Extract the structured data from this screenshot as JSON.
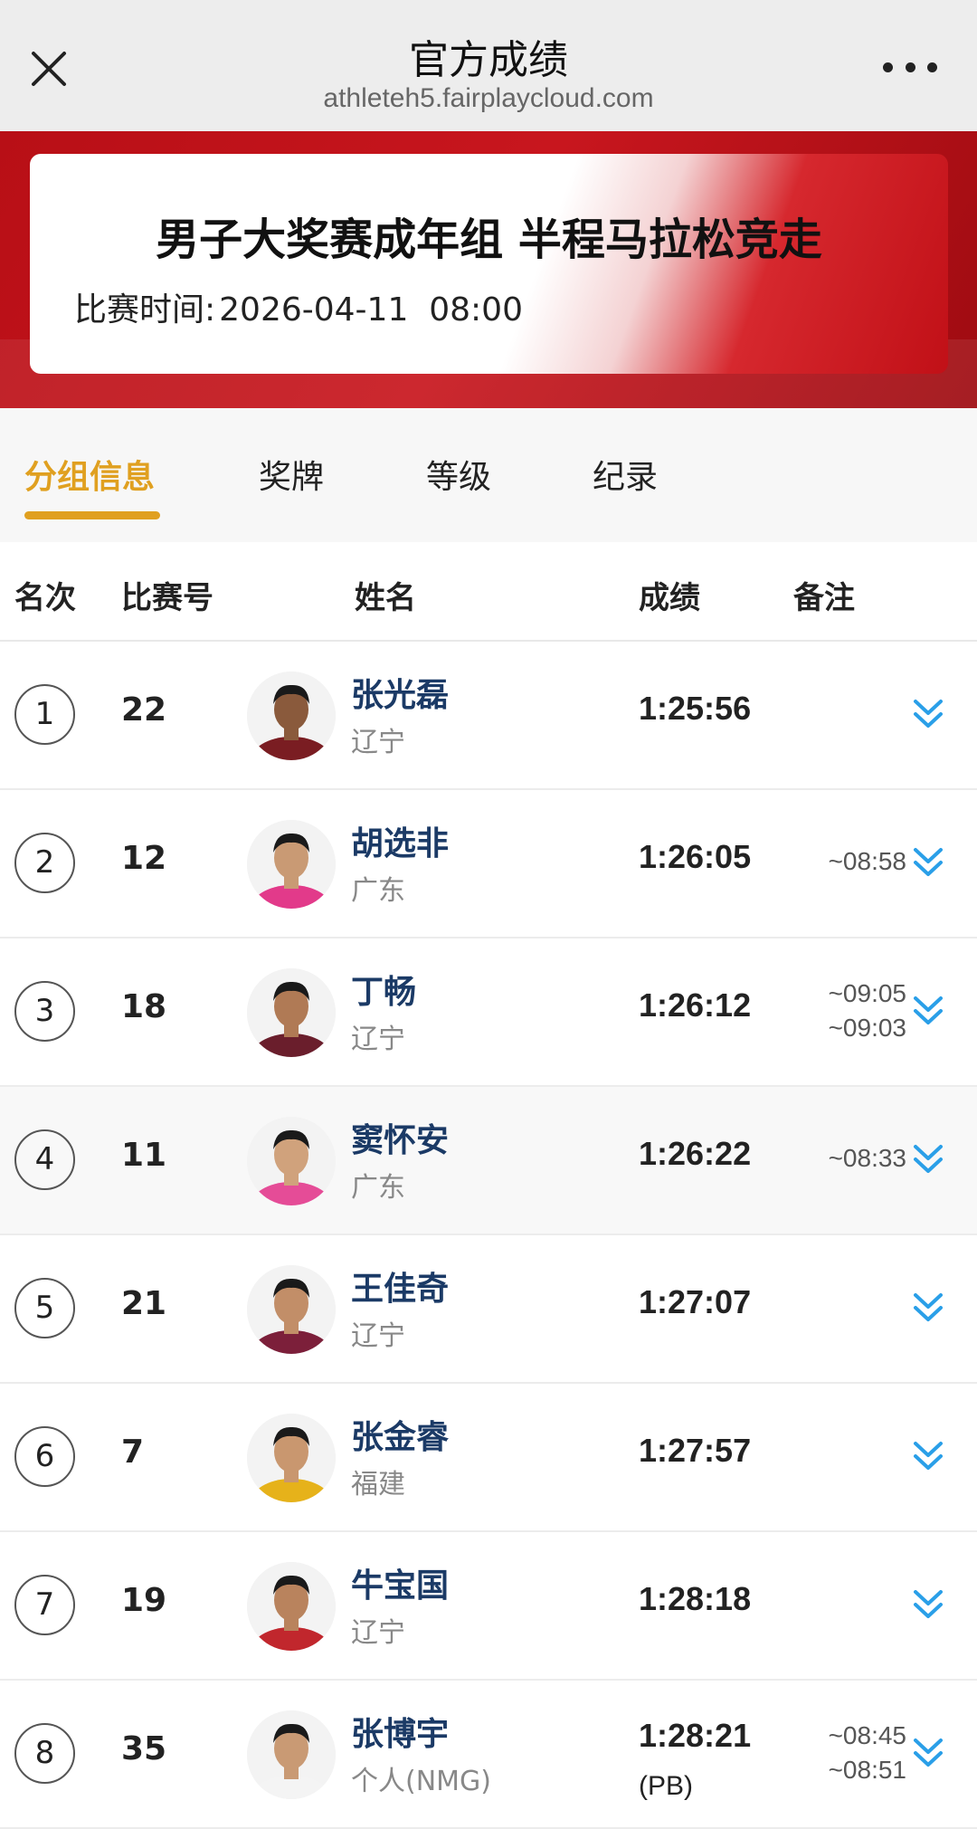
{
  "nav": {
    "title": "官方成绩",
    "url": "athleteh5.fairplaycloud.com"
  },
  "event": {
    "title": "男子大奖赛成年组 半程马拉松竞走",
    "time_label": "比赛时间:",
    "time_value": "2026-04-11  08:00"
  },
  "tabs": [
    "分组信息",
    "奖牌",
    "等级",
    "纪录"
  ],
  "table": {
    "headers": [
      "名次",
      "比赛号",
      "姓名",
      "成绩",
      "备注"
    ],
    "rows": [
      {
        "rank": "1",
        "bib": "22",
        "name": "张光磊",
        "team": "辽宁",
        "result": "1:25:56",
        "result_note": "",
        "notes": [],
        "kit": "#7a1d22",
        "skin": "#8a5a3c"
      },
      {
        "rank": "2",
        "bib": "12",
        "name": "胡选非",
        "team": "广东",
        "result": "1:26:05",
        "result_note": "",
        "notes": [
          "~08:58"
        ],
        "kit": "#e23a8a",
        "skin": "#c99a74"
      },
      {
        "rank": "3",
        "bib": "18",
        "name": "丁畅",
        "team": "辽宁",
        "result": "1:26:12",
        "result_note": "",
        "notes": [
          "~09:05",
          "~09:03"
        ],
        "kit": "#6a1e2c",
        "skin": "#b07a55"
      },
      {
        "rank": "4",
        "bib": "11",
        "name": "窦怀安",
        "team": "广东",
        "result": "1:26:22",
        "result_note": "",
        "notes": [
          "~08:33"
        ],
        "kit": "#e54c97",
        "skin": "#d0a27c"
      },
      {
        "rank": "5",
        "bib": "21",
        "name": "王佳奇",
        "team": "辽宁",
        "result": "1:27:07",
        "result_note": "",
        "notes": [],
        "kit": "#7c1f3a",
        "skin": "#c28e68"
      },
      {
        "rank": "6",
        "bib": "7",
        "name": "张金睿",
        "team": "福建",
        "result": "1:27:57",
        "result_note": "",
        "notes": [],
        "kit": "#e6b21a",
        "skin": "#c9976f"
      },
      {
        "rank": "7",
        "bib": "19",
        "name": "牛宝国",
        "team": "辽宁",
        "result": "1:28:18",
        "result_note": "",
        "notes": [],
        "kit": "#c1272d",
        "skin": "#b9835d"
      },
      {
        "rank": "8",
        "bib": "35",
        "name": "张博宇",
        "team": "个人(NMG)",
        "result": "1:28:21",
        "result_note": "(PB)",
        "notes": [
          "~08:45",
          "~08:51"
        ],
        "kit": "#f4f4f4",
        "skin": "#c99a74"
      }
    ]
  },
  "colors": {
    "accent": "#e0a020",
    "banner_red": "#c8161e",
    "name_blue": "#1b3a66",
    "expand_blue": "#2a9fe8"
  }
}
